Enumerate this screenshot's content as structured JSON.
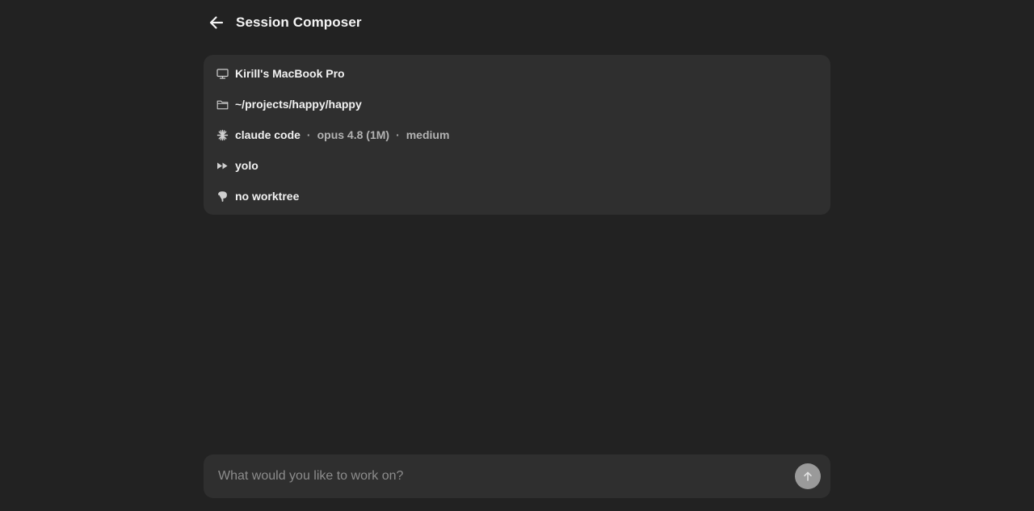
{
  "header": {
    "title": "Session Composer",
    "back_icon": "arrow-left-icon"
  },
  "settings": {
    "machine": {
      "icon": "monitor-icon",
      "label": "Kirill's MacBook Pro"
    },
    "directory": {
      "icon": "folder-icon",
      "label": "~/projects/happy/happy"
    },
    "agent": {
      "icon": "sparkle-icon",
      "name": "claude code",
      "separator": "·",
      "model": "opus 4.8 (1M)",
      "effort": "medium"
    },
    "permission": {
      "icon": "fast-forward-icon",
      "label": "yolo"
    },
    "worktree": {
      "icon": "branch-icon",
      "label": "no worktree"
    }
  },
  "composer": {
    "placeholder": "What would you like to work on?",
    "value": "",
    "send_icon": "arrow-up-icon"
  },
  "colors": {
    "background": "#222222",
    "card": "#2f2f2f",
    "text": "#f1f1f1",
    "muted": "#b2b2b2",
    "send_button": "#9a9a9a"
  }
}
